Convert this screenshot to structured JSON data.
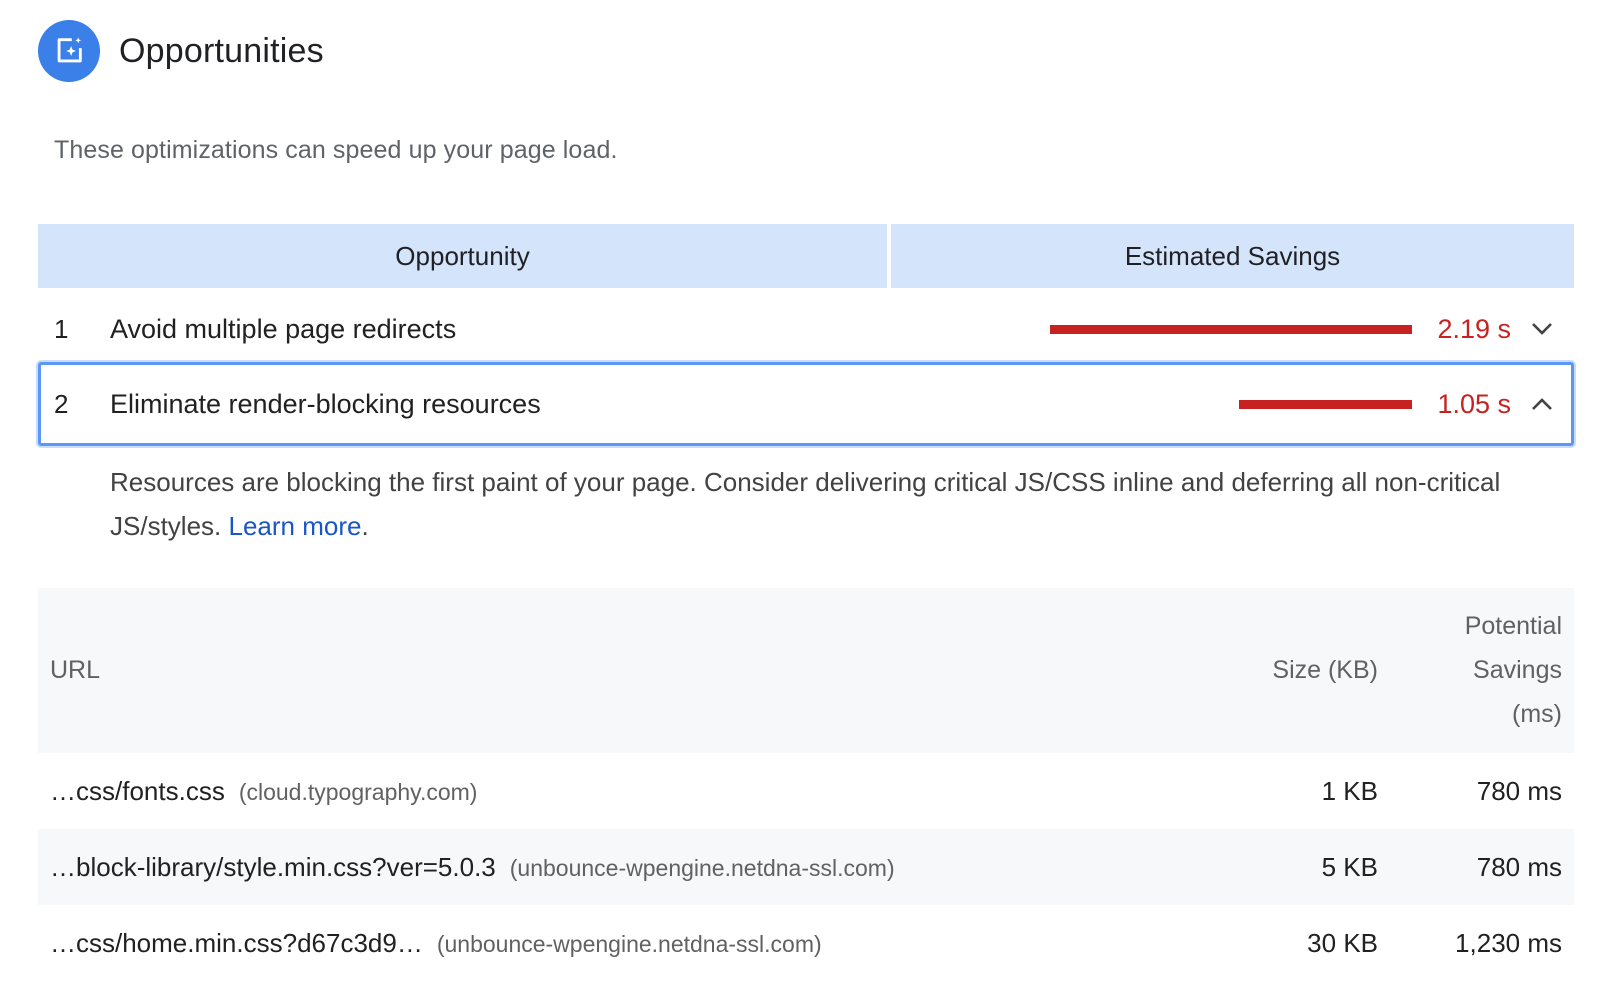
{
  "section": {
    "title": "Opportunities",
    "description": "These optimizations can speed up your page load.",
    "icon": "lighthouse-opportunity-icon",
    "icon_color": "#3b7fe8"
  },
  "opportunity_table": {
    "col_opportunity": "Opportunity",
    "col_savings": "Estimated Savings"
  },
  "opportunities": [
    {
      "index": "1",
      "title": "Avoid multiple page redirects",
      "savings": "2.19 s",
      "bar_fraction": 1.0,
      "expanded": false
    },
    {
      "index": "2",
      "title": "Eliminate render-blocking resources",
      "savings": "1.05 s",
      "bar_fraction": 0.479,
      "expanded": true
    }
  ],
  "detail": {
    "description": "Resources are blocking the first paint of your page. Consider delivering critical JS/CSS inline and deferring all non-critical JS/styles.",
    "learn_more": "Learn more",
    "trailing": "."
  },
  "resource_table": {
    "col_url": "URL",
    "col_size": "Size (KB)",
    "col_savings_1": "Potential",
    "col_savings_2": "Savings",
    "col_savings_3": "(ms)",
    "rows": [
      {
        "url": "…css/fonts.css",
        "host": "(cloud.typography.com)",
        "size": "1 KB",
        "savings": "780 ms"
      },
      {
        "url": "…block-library/style.min.css?ver=5.0.3",
        "host": "(unbounce-wpengine.netdna-ssl.com)",
        "size": "5 KB",
        "savings": "780 ms"
      },
      {
        "url": "…css/home.min.css?d67c3d9…",
        "host": "(unbounce-wpengine.netdna-ssl.com)",
        "size": "30 KB",
        "savings": "1,230 ms"
      }
    ]
  },
  "colors": {
    "fail_red": "#c7221f",
    "header_blue": "#d4e4fb",
    "focus_blue": "#5c97f5",
    "link_blue": "#1a56c4"
  }
}
